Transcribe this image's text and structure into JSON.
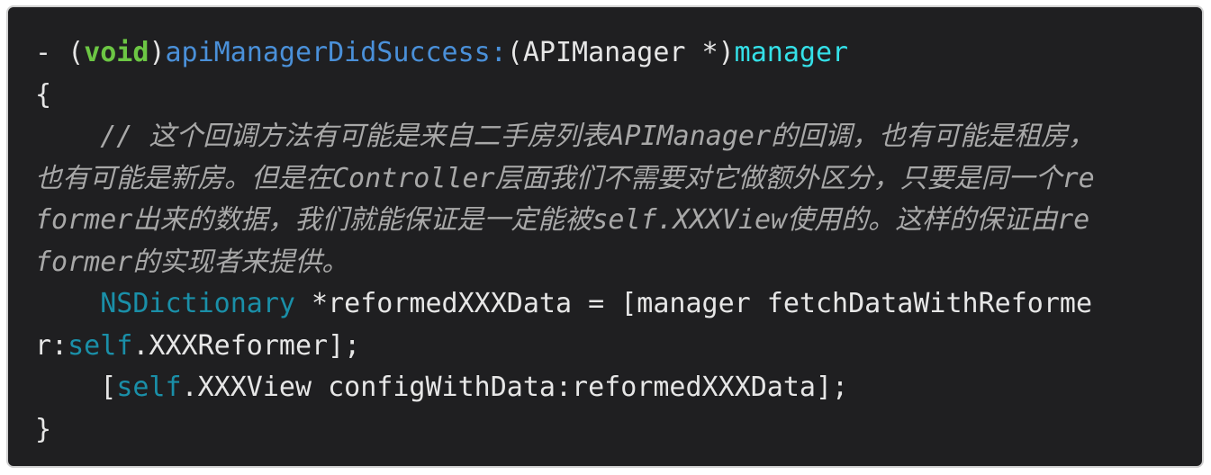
{
  "code": {
    "language": "objective-c",
    "lines": [
      {
        "parts": [
          "- (",
          "void",
          ")",
          "apiManagerDidSuccess:",
          "(APIManager *)",
          "manager"
        ]
      },
      {
        "parts": [
          "{"
        ]
      },
      {
        "parts": [
          "    // 这个回调方法有可能是来自二手房列表APIManager的回调，也有可能是租房，"
        ]
      },
      {
        "parts": [
          "也有可能是新房。但是在Controller层面我们不需要对它做额外区分，只要是同一个re"
        ]
      },
      {
        "parts": [
          "former出来的数据，我们就能保证是一定能被self.XXXView使用的。这样的保证由re"
        ]
      },
      {
        "parts": [
          "former的实现者来提供。"
        ]
      },
      {
        "parts": [
          "    ",
          "NSDictionary",
          " *reformedXXXData = [manager fetchDataWithReforme"
        ]
      },
      {
        "parts": [
          "r:",
          "self",
          ".XXXReformer];"
        ]
      },
      {
        "parts": [
          "    [",
          "self",
          ".XXXView configWithData:reformedXXXData];"
        ]
      },
      {
        "parts": [
          "}"
        ]
      }
    ]
  },
  "colors": {
    "background": "#1f1f21",
    "text": "#e6e6e6",
    "keyword": "#6cc644",
    "method": "#4a90d9",
    "param": "#34e0e8",
    "type": "#1a8fa8",
    "comment": "#a8a8a8"
  }
}
